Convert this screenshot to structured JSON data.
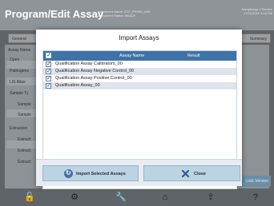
{
  "app": {
    "title": "Program/Edit Assay",
    "instrument_name_label": "Instrument Name:",
    "instrument_name_value": "ZOT_PR050_USE",
    "instrument_status_label": "Instrument Status:",
    "instrument_status_value": "READY",
    "user_line": "SampleApp // Service",
    "date_line": "17/01/2021 4:18 PM"
  },
  "background": {
    "left_tab": "General",
    "right_tab": "Summary",
    "side_items": [
      "Assay Name",
      "Open",
      "Pathogens",
      "LIS Alias",
      "Sample Ty",
      "Sample",
      "Sample",
      "Extraction",
      "Extracti",
      "Extracti",
      "Extracti"
    ],
    "right_button": "Lock Version"
  },
  "modal": {
    "title": "Import Assays",
    "columns": [
      "Assay Name",
      "Result"
    ],
    "rows": [
      {
        "name": "Qualification Assay Calibrators_00",
        "checked": true
      },
      {
        "name": "Qualification Assay Negative Control_00",
        "checked": true
      },
      {
        "name": "Qualification Assay Positive Control_00",
        "checked": true
      },
      {
        "name": "Qualification Assay_00",
        "checked": true
      }
    ],
    "import_button": "Import Selected Assays",
    "close_button": "Close"
  },
  "bottom_icons": [
    "lock-icon",
    "gear-icon",
    "wrench-icon",
    "home-icon",
    "export-icon",
    "help-icon"
  ],
  "colors": {
    "header_blue": "#3f72a8",
    "button_blue": "#bcd3e3",
    "close_x": "#2f5a92"
  }
}
